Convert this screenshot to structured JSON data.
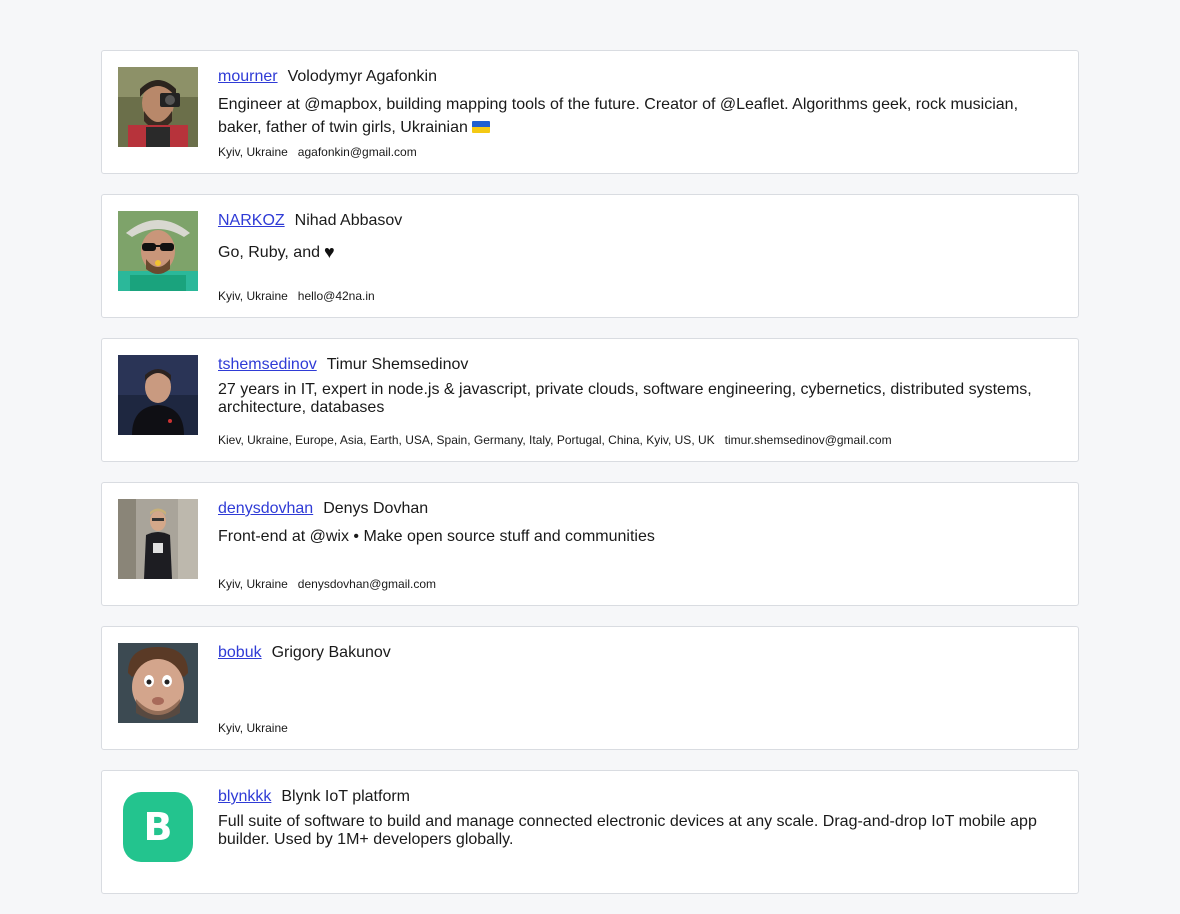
{
  "users": [
    {
      "login": "mourner",
      "name": "Volodymyr Agafonkin",
      "bio": "Engineer at @mapbox, building mapping tools of the future. Creator of @Leaflet. Algorithms geek, rock musician, baker, father of twin girls, Ukrainian",
      "location": "Kyiv, Ukraine",
      "email": "agafonkin@gmail.com"
    },
    {
      "login": "NARKOZ",
      "name": "Nihad Abbasov",
      "bio": "Go, Ruby, and",
      "location": "Kyiv, Ukraine",
      "email": "hello@42na.in"
    },
    {
      "login": "tshemsedinov",
      "name": "Timur Shemsedinov",
      "bio": "27 years in IT, expert in node.js & javascript, private clouds, software engineering, cybernetics, distributed systems, architecture, databases",
      "location": "Kiev, Ukraine, Europe, Asia, Earth, USA, Spain, Germany, Italy, Portugal, China, Kyiv, US, UK",
      "email": "timur.shemsedinov@gmail.com"
    },
    {
      "login": "denysdovhan",
      "name": "Denys Dovhan",
      "bio": "Front-end at @wix • Make open source stuff and communities",
      "location": "Kyiv, Ukraine",
      "email": "denysdovhan@gmail.com"
    },
    {
      "login": "bobuk",
      "name": "Grigory Bakunov",
      "bio": "",
      "location": "Kyiv, Ukraine",
      "email": ""
    },
    {
      "login": "blynkkk",
      "name": "Blynk IoT platform",
      "bio": "Full suite of software to build and manage connected electronic devices at any scale. Drag-and-drop IoT mobile app builder. Used by 1M+ developers globally.",
      "location": "",
      "email": "",
      "avatar_letter": "B"
    }
  ],
  "colors": {
    "link": "#2f3bd6",
    "background": "#f6f7f9",
    "border": "#d9dce1",
    "blynk_green": "#23c48e"
  },
  "icons": {
    "ukraine_flag": "ukraine-flag-icon",
    "black_heart": "black-heart-icon"
  }
}
